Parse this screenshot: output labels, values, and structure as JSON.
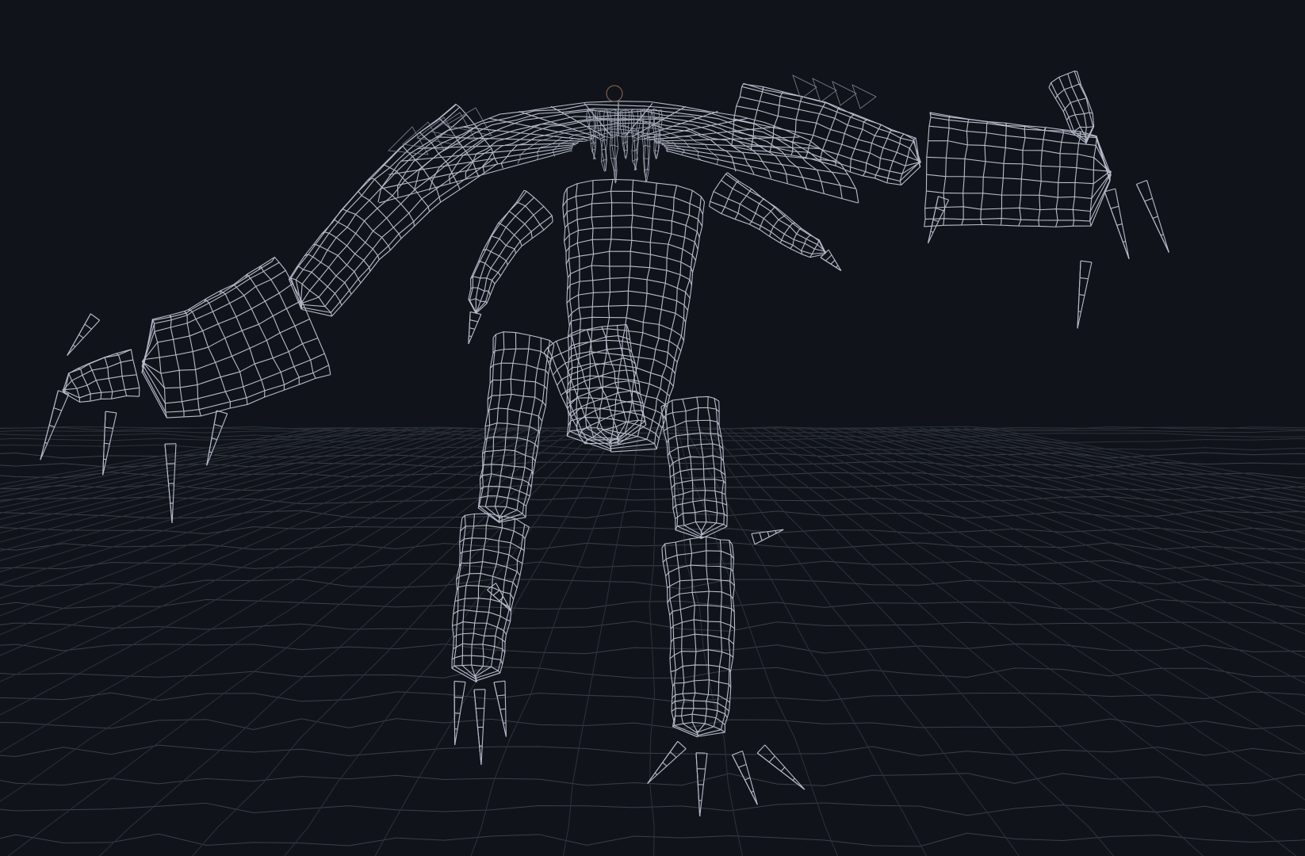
{
  "scene": {
    "background_color": "#10141a",
    "grid_color": "#3a3f4a",
    "wireframe_color": "#b8bccb",
    "accent_color": "#9a6a55",
    "render_mode": "wireframe",
    "subject": "creature-model",
    "ground": "wireframe-grid-plane"
  }
}
